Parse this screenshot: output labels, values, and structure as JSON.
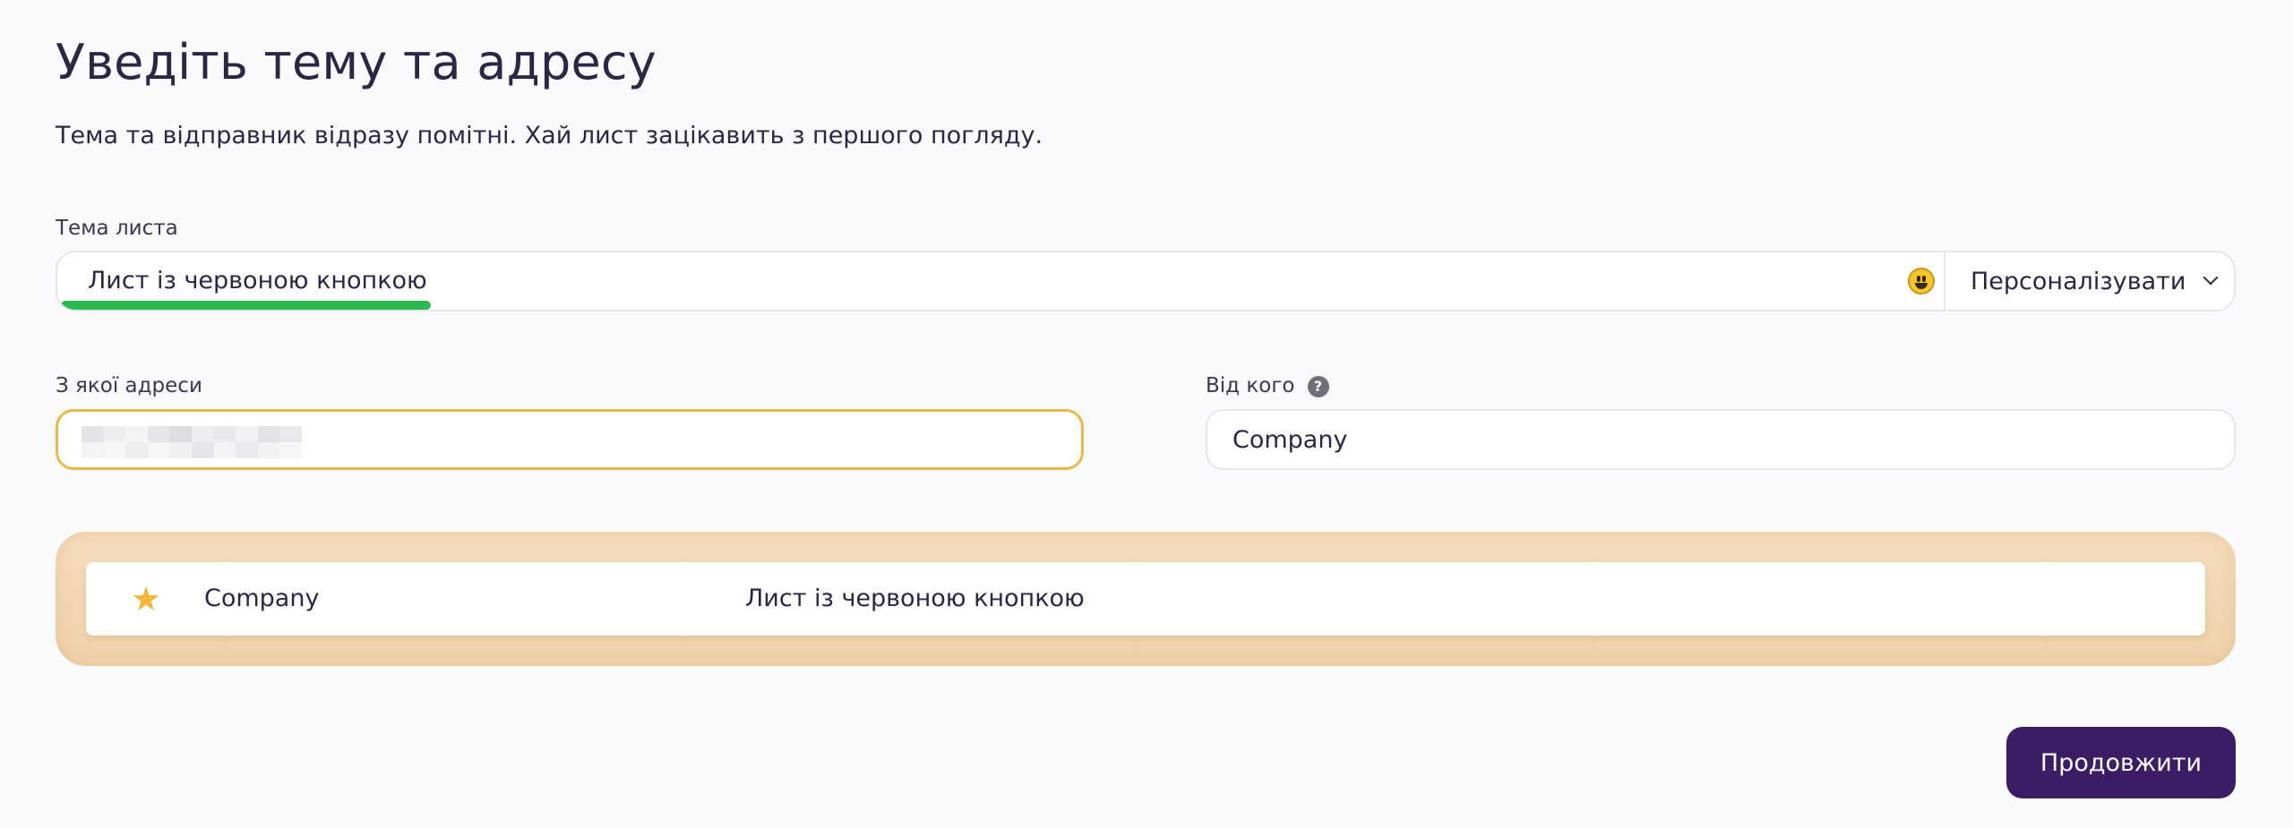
{
  "header": {
    "title": "Уведіть тему та адресу",
    "subtitle": "Тема та відправник відразу помітні. Хай лист зацікавить з першого погляду."
  },
  "subject": {
    "label": "Тема листа",
    "value": "Лист із червоною кнопкою",
    "length_indicator_fraction": 0.17,
    "length_indicator_color": "#2bb94f",
    "emoji_icon": "smiley-icon",
    "personalize_label": "Персоналізувати"
  },
  "from_address": {
    "label": "З якої адреси",
    "value": "",
    "border_color": "#e9b84a"
  },
  "sender_name": {
    "label": "Від кого",
    "help_glyph": "?",
    "value": "Company"
  },
  "preview": {
    "star_icon": "star-icon",
    "star_glyph": "★",
    "star_color": "#f1b73c",
    "sender": "Company",
    "subject": "Лист із червоною кнопкою"
  },
  "actions": {
    "continue_label": "Продовжити",
    "continue_color": "#3b1d66"
  }
}
